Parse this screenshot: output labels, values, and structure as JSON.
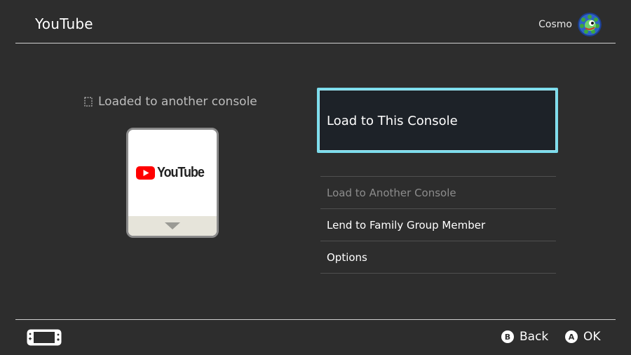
{
  "header": {
    "title": "YouTube",
    "user_name": "Cosmo"
  },
  "status": {
    "icon": "dashed-square-icon",
    "text": "Loaded to another console"
  },
  "software_card": {
    "logo_text": "YouTube",
    "logo_icon": "youtube-play-icon",
    "brand_color": "#ff0000"
  },
  "menu": {
    "primary": "Load to This Console",
    "items": [
      {
        "label": "Load to Another Console",
        "disabled": true
      },
      {
        "label": "Lend to Family Group Member",
        "disabled": false
      },
      {
        "label": "Options",
        "disabled": false
      }
    ]
  },
  "footer": {
    "device_icon": "switch-console-icon",
    "hints": [
      {
        "button": "B",
        "label": "Back"
      },
      {
        "button": "A",
        "label": "OK"
      }
    ]
  },
  "colors": {
    "background": "#2d2d2d",
    "focus_border": "#7bdcec",
    "primary_fill": "#1d2228",
    "disabled_text": "#8c8c8c"
  }
}
